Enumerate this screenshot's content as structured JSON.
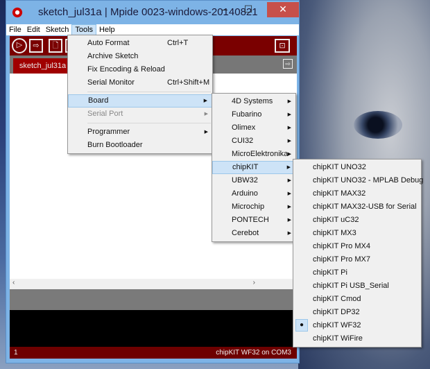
{
  "window": {
    "title": "sketch_jul31a | Mpide 0023-windows-20140821",
    "minimize": "–",
    "maximize": "☐",
    "close": "✕"
  },
  "menubar": [
    "File",
    "Edit",
    "Sketch",
    "Tools",
    "Help"
  ],
  "tab": "sketch_jul31a",
  "tools_menu": [
    {
      "label": "Auto Format",
      "shortcut": "Ctrl+T"
    },
    {
      "label": "Archive Sketch"
    },
    {
      "label": "Fix Encoding & Reload"
    },
    {
      "label": "Serial Monitor",
      "shortcut": "Ctrl+Shift+M"
    },
    {
      "label": "Board"
    },
    {
      "label": "Serial Port"
    },
    {
      "label": "Programmer"
    },
    {
      "label": "Burn Bootloader"
    }
  ],
  "board_menu": [
    "4D Systems",
    "Fubarino",
    "Olimex",
    "CUI32",
    "MicroElektronika",
    "chipKIT",
    "UBW32",
    "Arduino",
    "Microchip",
    "PONTECH",
    "Cerebot"
  ],
  "chipkit_menu": [
    "chipKIT UNO32",
    "chipKIT UNO32 - MPLAB Debug",
    "chipKIT MAX32",
    "chipKIT MAX32-USB for Serial",
    "chipKIT uC32",
    "chipKIT MX3",
    "chipKIT Pro MX4",
    "chipKIT Pro MX7",
    "chipKIT Pi",
    "chipKIT Pi USB_Serial",
    "chipKIT Cmod",
    "chipKIT DP32",
    "chipKIT WF32",
    "chipKIT WiFire"
  ],
  "selected_board": "chipKIT WF32",
  "status": {
    "line": "1",
    "board": "chipKIT WF32 on COM3"
  }
}
